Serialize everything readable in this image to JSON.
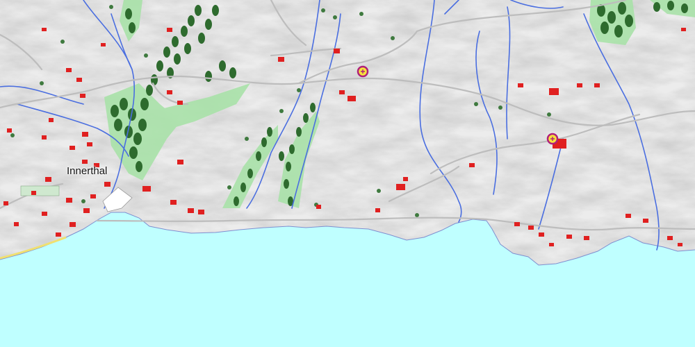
{
  "map": {
    "place_label": "Innerthal",
    "colors": {
      "lake": "#bfffff",
      "terrain": "#ececec",
      "forest": "#2e6b2e",
      "forest_edge": "#9fdc9f",
      "stream": "#4a6ee0",
      "road": "#bdbdbd",
      "main_road": "#f0e070",
      "building": "#e02020",
      "poi": "#b0207a"
    },
    "symbols": [
      "chapel-icon",
      "chapel-icon"
    ]
  }
}
